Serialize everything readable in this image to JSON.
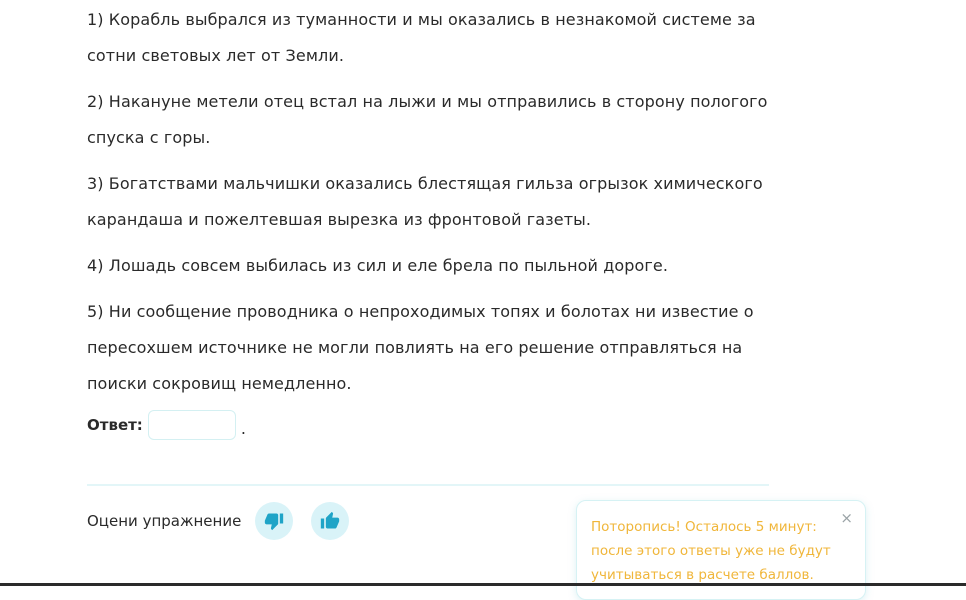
{
  "exercise": {
    "sentences": [
      "1) Корабль выбрался из туманности и мы оказались в незнакомой системе за сотни световых лет от Земли.",
      "2) Накануне метели отец встал на лыжи и мы отправились в сторону пологого спуска с горы.",
      "3) Богатствами мальчишки оказались блестящая гильза огрызок химического карандаша и пожелтевшая вырезка из фронтовой газеты.",
      "4) Лошадь совсем выбилась из сил и еле брела по пыльной дороге.",
      "5) Ни сообщение проводника о непроходимых топях и болотах ни известие о пересохшем источнике не могли повлиять на его решение отправляться на поиски сокровищ немедленно."
    ],
    "answer_label": "Ответ:",
    "answer_value": "",
    "answer_suffix": "."
  },
  "rating": {
    "label": "Оцени упражнение",
    "dislike_icon": "thumb-down-icon",
    "like_icon": "thumb-up-icon",
    "button_color": "#d9f3f8",
    "icon_color": "#1fa4c7"
  },
  "toast": {
    "message": "Поторопись! Осталось 5 минут: после этого ответы уже не будут учитываться в расчете баллов.",
    "close_label": "×",
    "text_color": "#f0b63a"
  }
}
